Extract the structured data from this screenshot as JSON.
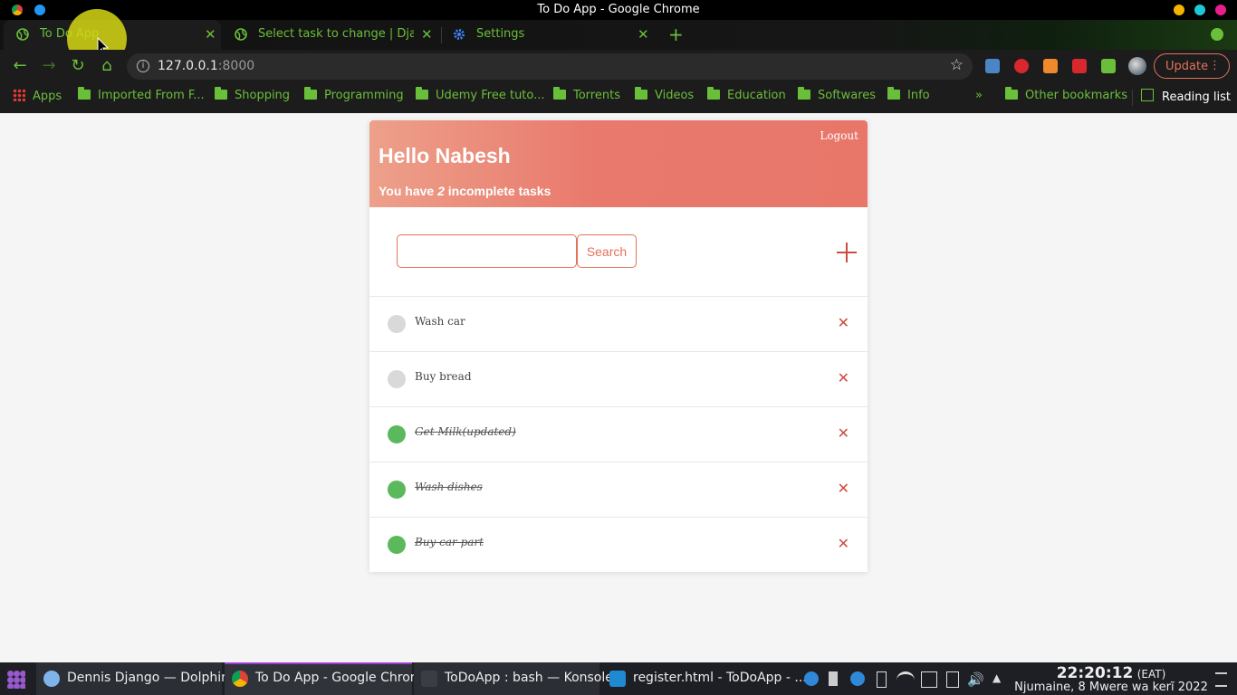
{
  "window": {
    "title": "To Do App - Google Chrome"
  },
  "tabs": [
    {
      "label": "To Do App",
      "icon": "globe-icon"
    },
    {
      "label": "Select task to change | Djang",
      "icon": "globe-icon"
    },
    {
      "label": "Settings",
      "icon": "gear-icon"
    }
  ],
  "address_bar": {
    "host": "127.0.0.1",
    "port": ":8000"
  },
  "toolbar": {
    "update_label": "Update"
  },
  "bookmarks": [
    {
      "label": "Apps",
      "icon": "apps-grid-icon"
    },
    {
      "label": "Imported From F...",
      "icon": "folder-icon"
    },
    {
      "label": "Shopping",
      "icon": "folder-icon"
    },
    {
      "label": "Programming",
      "icon": "folder-icon"
    },
    {
      "label": "Udemy Free tuto...",
      "icon": "folder-icon"
    },
    {
      "label": "Torrents",
      "icon": "folder-icon"
    },
    {
      "label": "Videos",
      "icon": "folder-icon"
    },
    {
      "label": "Education",
      "icon": "folder-icon"
    },
    {
      "label": "Softwares",
      "icon": "folder-icon"
    },
    {
      "label": "Info",
      "icon": "folder-icon"
    }
  ],
  "bookmarks_extra": {
    "overflow": "»",
    "other": "Other bookmarks",
    "reading_list": "Reading list"
  },
  "app": {
    "logout": "Logout",
    "greeting": "Hello Nabesh",
    "sub_prefix": "You have",
    "incomplete_count": "2",
    "sub_suffix": "incomplete tasks",
    "search_button": "Search",
    "search_value": "",
    "tasks": [
      {
        "title": "Wash car",
        "complete": false
      },
      {
        "title": "Buy bread",
        "complete": false
      },
      {
        "title": "Get Milk(updated)",
        "complete": true
      },
      {
        "title": "Wash dishes",
        "complete": true
      },
      {
        "title": "Buy car part",
        "complete": true
      }
    ]
  },
  "colors": {
    "accent": "#e2725b",
    "done": "#5cb85c",
    "chrome_green": "#6abf3a"
  },
  "taskbar": {
    "items": [
      {
        "label": "Dennis Django — Dolphin"
      },
      {
        "label": "To Do App - Google Chrome"
      },
      {
        "label": "ToDoApp : bash — Konsole"
      },
      {
        "label": "register.html - ToDoApp - ..."
      }
    ],
    "time": "22:20:12",
    "tz": "(EAT)",
    "date": "Njumaine, 8 Mwere wa kerĩ 2022"
  }
}
